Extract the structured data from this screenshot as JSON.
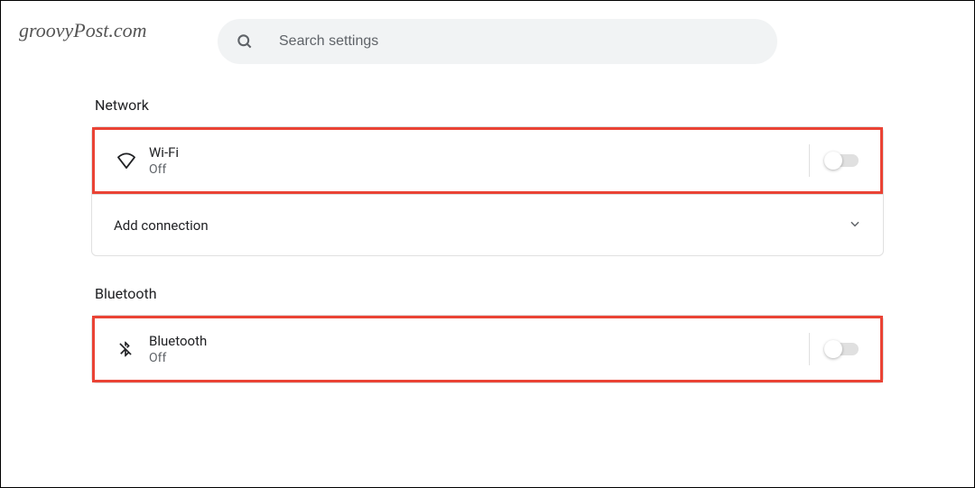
{
  "watermark": "groovyPost.com",
  "search": {
    "placeholder": "Search settings"
  },
  "sections": {
    "network": {
      "title": "Network",
      "wifi": {
        "label": "Wi-Fi",
        "status": "Off"
      },
      "add_connection": {
        "label": "Add connection"
      }
    },
    "bluetooth": {
      "title": "Bluetooth",
      "bt": {
        "label": "Bluetooth",
        "status": "Off"
      }
    }
  }
}
